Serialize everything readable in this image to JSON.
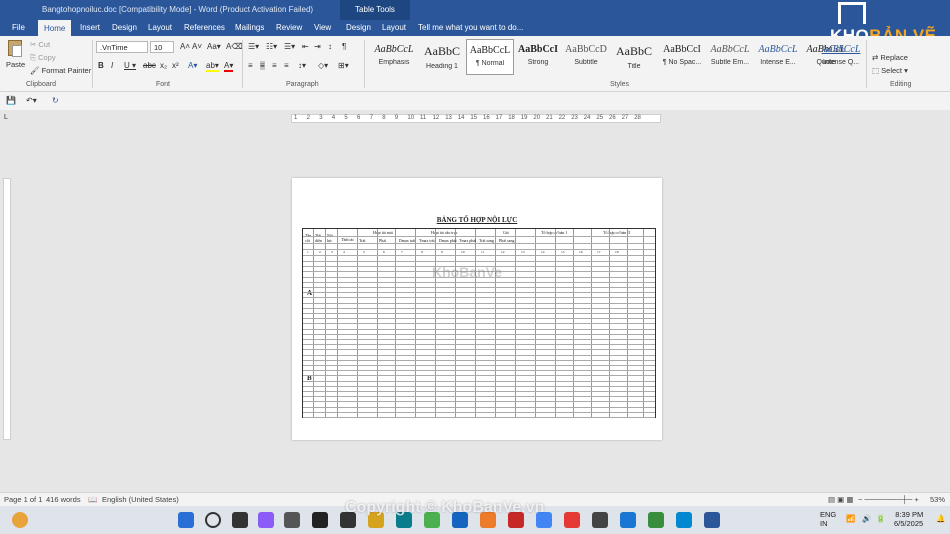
{
  "titlebar": {
    "document": "Bangtohopnoiluc.doc [Compatibility Mode] - Word (Product Activation Failed)",
    "context_tab": "Table Tools"
  },
  "logo": {
    "text_a": "KHO",
    "text_b": "BẢN VẼ"
  },
  "tabs": [
    "File",
    "Home",
    "Insert",
    "Design",
    "Layout",
    "References",
    "Mailings",
    "Review",
    "View",
    "Design",
    "Layout"
  ],
  "tell_me": "Tell me what you want to do...",
  "ribbon": {
    "clipboard": {
      "paste": "Paste",
      "cut": "Cut",
      "copy": "Copy",
      "format_painter": "Format Painter",
      "label": "Clipboard"
    },
    "font": {
      "name": ".VnTime",
      "size": "10",
      "label": "Font"
    },
    "paragraph": {
      "label": "Paragraph"
    },
    "styles": {
      "label": "Styles",
      "items": [
        {
          "preview": "AaBbCcL",
          "name": "Emphasis"
        },
        {
          "preview": "AaBbC",
          "name": "Heading 1"
        },
        {
          "preview": "AaBbCcL",
          "name": "¶ Normal"
        },
        {
          "preview": "AaBbCcI",
          "name": "Strong"
        },
        {
          "preview": "AaBbCcD",
          "name": "Subtitle"
        },
        {
          "preview": "AaBbC",
          "name": "Title"
        },
        {
          "preview": "AaBbCcI",
          "name": "¶ No Spac..."
        },
        {
          "preview": "AaBbCcL",
          "name": "Subtle Em..."
        },
        {
          "preview": "AaBbCcL",
          "name": "Intense E..."
        },
        {
          "preview": "AaBbCcL",
          "name": "Quote"
        },
        {
          "preview": "AaBbCcL",
          "name": "Intense Q..."
        }
      ]
    },
    "editing": {
      "find": "Find",
      "replace": "Replace",
      "select": "Select",
      "label": "Editing"
    }
  },
  "ruler_numbers": [
    "1",
    "2",
    "3",
    "4",
    "5",
    "6",
    "7",
    "8",
    "9",
    "10",
    "11",
    "12",
    "13",
    "14",
    "15",
    "16",
    "17",
    "18",
    "19",
    "20",
    "21",
    "22",
    "23",
    "24",
    "25",
    "26",
    "27",
    "28"
  ],
  "document": {
    "title": "BẢNG TỔ HỢP NỘI LỰC",
    "headers": [
      "Tên cột",
      "Tiết diện",
      "Nội lực",
      "Tĩnh tải",
      "Hoạt tải mái",
      "Hoạt tải cầu trục",
      "Gió",
      "Tổ hợp cơ bản 1",
      "Tổ hợp cơ bản II"
    ],
    "sub_headers": [
      "Trái",
      "Phải",
      "Dmax trái",
      "Tmax trái",
      "Dmax phải",
      "Tmax phải",
      "Trái sang",
      "Phải sang"
    ],
    "col_numbers": [
      "1",
      "2",
      "3",
      "4",
      "5",
      "6",
      "7",
      "8",
      "9",
      "10",
      "11",
      "12",
      "13",
      "14",
      "15",
      "16",
      "17",
      "18"
    ],
    "columns": [
      "A",
      "B"
    ],
    "watermark": "KhoBanVe"
  },
  "status": {
    "page": "Page 1 of 1",
    "words": "416 words",
    "language": "English (United States)",
    "zoom": "53%"
  },
  "taskbar": {
    "lang1": "ENG",
    "lang2": "IN",
    "time": "8:39 PM",
    "date": "6/5/2025"
  },
  "copyright": "Copyright © KhoBanVe.vn"
}
